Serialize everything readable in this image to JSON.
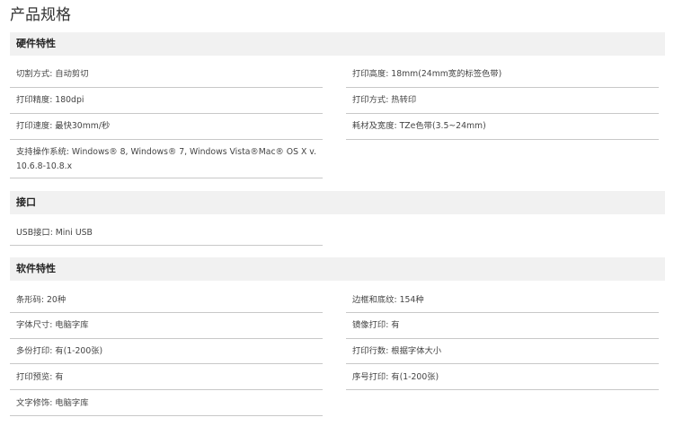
{
  "page_title": "产品规格",
  "sections": [
    {
      "title": "硬件特性",
      "left": [
        {
          "label": "切割方式",
          "value": "自动剪切"
        },
        {
          "label": "打印精度",
          "value": "180dpi"
        },
        {
          "label": "打印速度",
          "value": "最快30mm/秒"
        },
        {
          "label": "支持操作系统",
          "value": "Windows® 8, Windows® 7, Windows Vista®Mac® OS X v. 10.6.8-10.8.x"
        }
      ],
      "right": [
        {
          "label": "打印高度",
          "value": "18mm(24mm宽的标签色带)"
        },
        {
          "label": "打印方式",
          "value": "热转印"
        },
        {
          "label": "耗材及宽度",
          "value": "TZe色带(3.5~24mm)"
        }
      ]
    },
    {
      "title": "接口",
      "left": [
        {
          "label": "USB接口",
          "value": "Mini USB"
        }
      ],
      "right": []
    },
    {
      "title": "软件特性",
      "left": [
        {
          "label": "条形码",
          "value": "20种"
        },
        {
          "label": "字体尺寸",
          "value": "电脑字库"
        },
        {
          "label": "多份打印",
          "value": "有(1-200张)"
        },
        {
          "label": "打印预览",
          "value": "有"
        },
        {
          "label": "文字修饰",
          "value": "电脑字库"
        }
      ],
      "right": [
        {
          "label": "边框和底纹",
          "value": "154种"
        },
        {
          "label": "镜像打印",
          "value": "有"
        },
        {
          "label": "打印行数",
          "value": "根据字体大小"
        },
        {
          "label": "序号打印",
          "value": "有(1-200张)"
        }
      ]
    }
  ]
}
